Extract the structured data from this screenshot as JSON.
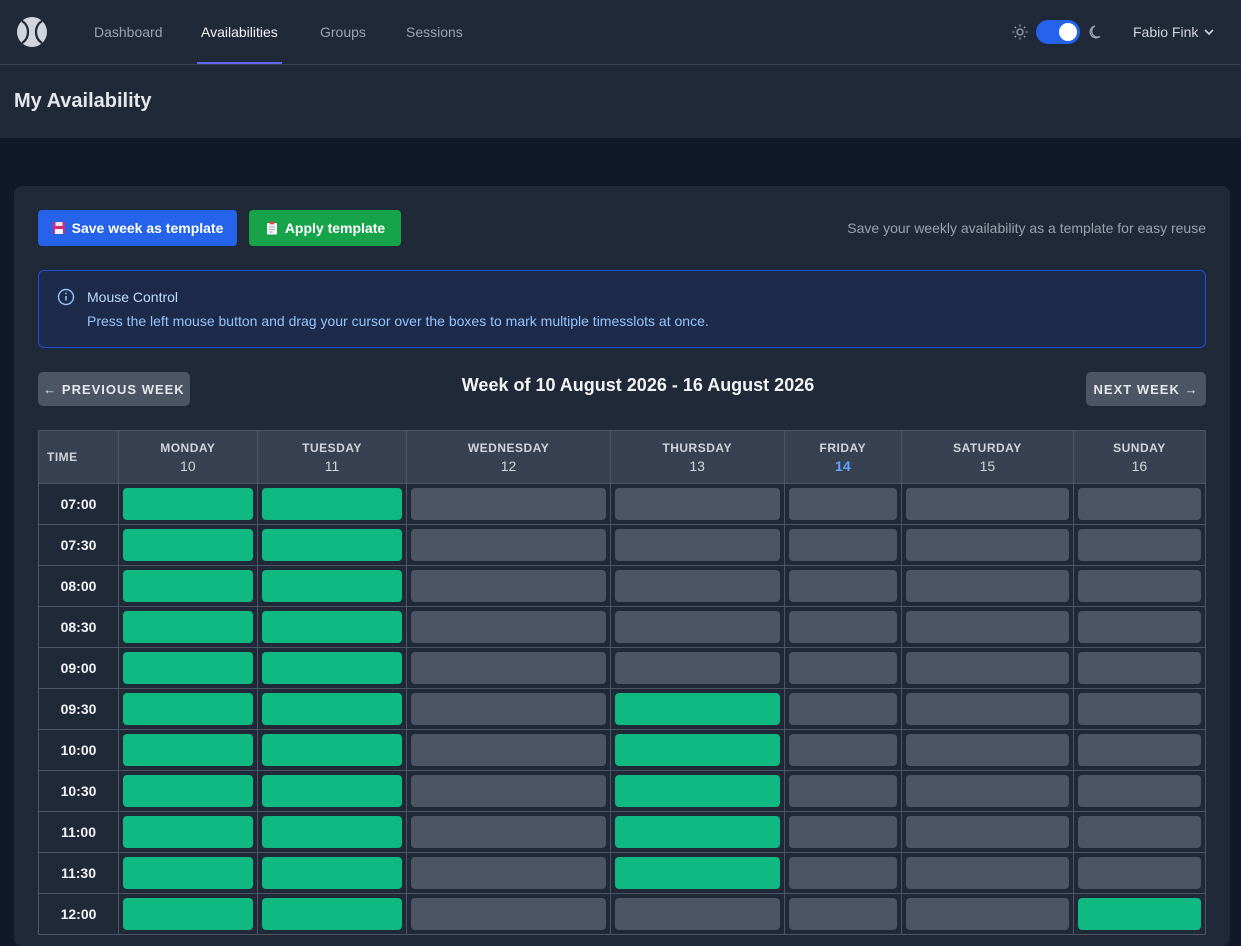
{
  "nav": {
    "links": [
      {
        "label": "Dashboard",
        "active": false
      },
      {
        "label": "Availabilities",
        "active": true
      },
      {
        "label": "Groups",
        "active": false
      },
      {
        "label": "Sessions",
        "active": false
      }
    ],
    "user_name": "Fabio Fink",
    "dark_mode": true
  },
  "header": {
    "title": "My Availability"
  },
  "toolbar": {
    "save_template_label": "Save week as template",
    "save_template_icon": "floppy-disk-icon",
    "apply_template_label": "Apply template",
    "apply_template_icon": "clipboard-icon",
    "hint": "Save your weekly availability as a template for easy reuse"
  },
  "info": {
    "title": "Mouse Control",
    "text": "Press the left mouse button and drag your cursor over the boxes to mark multiple timesslots at once."
  },
  "week": {
    "prev_label": "← PREVIOUS WEEK",
    "next_label": "NEXT WEEK →",
    "title": "Week of 10 August 2026 - 16 August 2026"
  },
  "grid": {
    "time_header": "TIME",
    "days": [
      {
        "name": "MONDAY",
        "num": "10",
        "today": false
      },
      {
        "name": "TUESDAY",
        "num": "11",
        "today": false
      },
      {
        "name": "WEDNESDAY",
        "num": "12",
        "today": false
      },
      {
        "name": "THURSDAY",
        "num": "13",
        "today": false
      },
      {
        "name": "FRIDAY",
        "num": "14",
        "today": true
      },
      {
        "name": "SATURDAY",
        "num": "15",
        "today": false
      },
      {
        "name": "SUNDAY",
        "num": "16",
        "today": false
      }
    ],
    "rows": [
      {
        "time": "07:00",
        "slots": [
          1,
          1,
          0,
          0,
          0,
          0,
          0
        ]
      },
      {
        "time": "07:30",
        "slots": [
          1,
          1,
          0,
          0,
          0,
          0,
          0
        ]
      },
      {
        "time": "08:00",
        "slots": [
          1,
          1,
          0,
          0,
          0,
          0,
          0
        ]
      },
      {
        "time": "08:30",
        "slots": [
          1,
          1,
          0,
          0,
          0,
          0,
          0
        ]
      },
      {
        "time": "09:00",
        "slots": [
          1,
          1,
          0,
          0,
          0,
          0,
          0
        ]
      },
      {
        "time": "09:30",
        "slots": [
          1,
          1,
          0,
          1,
          0,
          0,
          0
        ]
      },
      {
        "time": "10:00",
        "slots": [
          1,
          1,
          0,
          1,
          0,
          0,
          0
        ]
      },
      {
        "time": "10:30",
        "slots": [
          1,
          1,
          0,
          1,
          0,
          0,
          0
        ]
      },
      {
        "time": "11:00",
        "slots": [
          1,
          1,
          0,
          1,
          0,
          0,
          0
        ]
      },
      {
        "time": "11:30",
        "slots": [
          1,
          1,
          0,
          1,
          0,
          0,
          0
        ]
      },
      {
        "time": "12:00",
        "slots": [
          1,
          1,
          0,
          0,
          0,
          0,
          1
        ]
      }
    ]
  },
  "colors": {
    "available": "#10b981",
    "unavailable": "#4b5563",
    "accent": "#6366f1",
    "primary": "#2563eb",
    "success": "#16a34a"
  }
}
